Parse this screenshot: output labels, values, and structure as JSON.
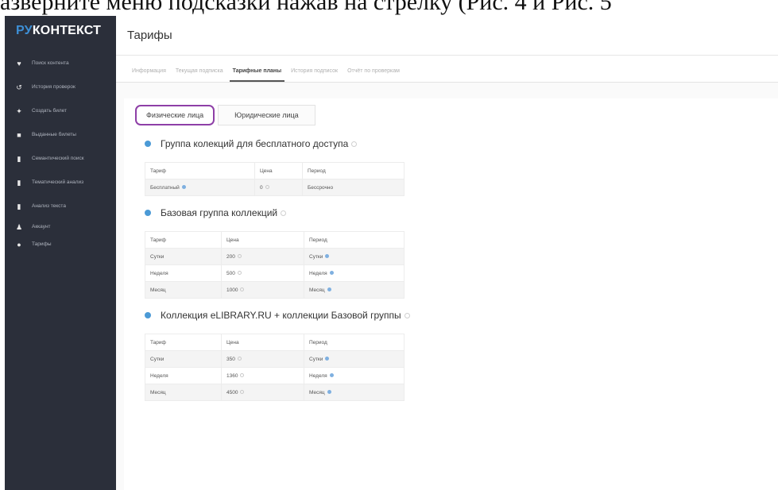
{
  "doc_text": "азверните меню подсказки нажав на стрелку (Рис. 4 и Рис. 5",
  "logo": {
    "ru": "РУ",
    "rest": "КОНТЕКСТ"
  },
  "sidebar": {
    "items": [
      {
        "icon": "heart-icon",
        "glyph": "♥",
        "label": "Поиск контента"
      },
      {
        "icon": "history-icon",
        "glyph": "↺",
        "label": "История проверок"
      },
      {
        "icon": "create-icon",
        "glyph": "✦",
        "label": "Создать билет"
      },
      {
        "icon": "folder-icon",
        "glyph": "■",
        "label": "Выданные билеты"
      },
      {
        "icon": "document-icon",
        "glyph": "▮",
        "label": "Семантический поиск"
      },
      {
        "icon": "document-icon",
        "glyph": "▮",
        "label": "Тематический анализ"
      },
      {
        "icon": "document-icon",
        "glyph": "▮",
        "label": "Анализ текста"
      },
      {
        "icon": "user-icon",
        "glyph": "♟",
        "label": "Аккаунт"
      },
      {
        "icon": "circle-icon",
        "glyph": "●",
        "label": "Тарифы"
      }
    ]
  },
  "header": {
    "title": "Тарифы"
  },
  "tabs": [
    {
      "label": "Информация",
      "active": false
    },
    {
      "label": "Текущая подписка",
      "active": false
    },
    {
      "label": "Тарифные планы",
      "active": true
    },
    {
      "label": "История подписок",
      "active": false
    },
    {
      "label": "Отчёт по проверкам",
      "active": false
    }
  ],
  "segments": {
    "individuals": "Физические лица",
    "legal": "Юридические лица"
  },
  "sections": [
    {
      "title": "Группа колекций для бесплатного доступа",
      "headers": [
        "Тариф",
        "Цена",
        "Период"
      ],
      "rows": [
        [
          "Бесплатный",
          "0",
          "Бессрочно"
        ]
      ]
    },
    {
      "title": "Базовая группа коллекций",
      "headers": [
        "Тариф",
        "Цена",
        "Период"
      ],
      "rows": [
        [
          "Сутки",
          "200",
          "Сутки"
        ],
        [
          "Неделя",
          "500",
          "Неделя"
        ],
        [
          "Месяц",
          "1000",
          "Месяц"
        ]
      ]
    },
    {
      "title": "Коллекция eLIBRARY.RU + коллекции Базовой группы",
      "headers": [
        "Тариф",
        "Цена",
        "Период"
      ],
      "rows": [
        [
          "Сутки",
          "350",
          "Сутки"
        ],
        [
          "Неделя",
          "1360",
          "Неделя"
        ],
        [
          "Месяц",
          "4500",
          "Месяц"
        ]
      ]
    }
  ],
  "colors": {
    "sidebar_bg": "#2b2f3a",
    "accent": "#3d8fd6",
    "highlight": "#8e3fa7"
  }
}
